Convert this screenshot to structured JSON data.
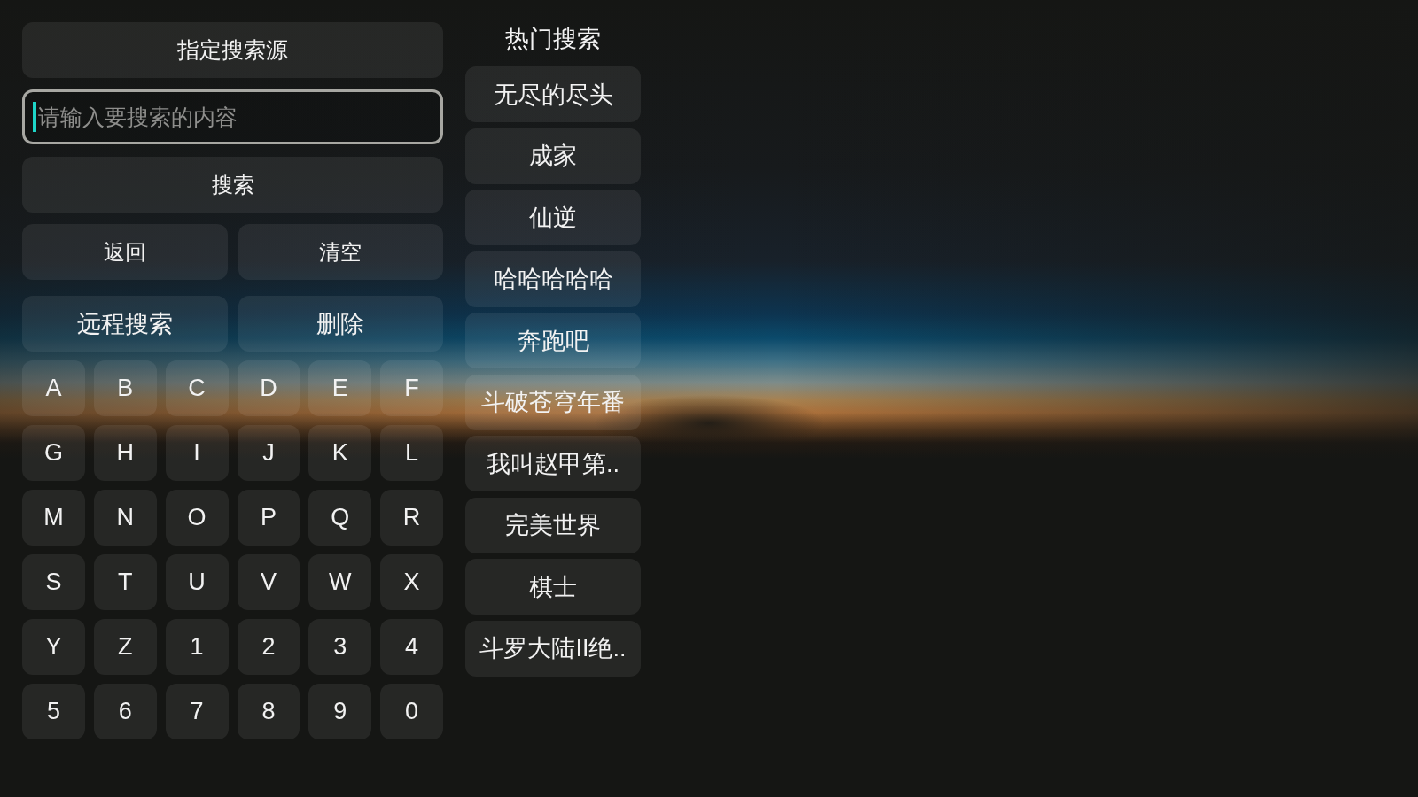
{
  "source_button": {
    "label": "指定搜索源"
  },
  "search_field": {
    "placeholder": "请输入要搜索的内容",
    "focused": true
  },
  "search_button": {
    "label": "搜索"
  },
  "action_rows": [
    {
      "buttons": [
        {
          "label": "返回"
        },
        {
          "label": "清空"
        }
      ]
    },
    {
      "buttons": [
        {
          "label": "远程搜索"
        },
        {
          "label": "删除"
        }
      ]
    }
  ],
  "keyboard": {
    "keys": [
      "A",
      "B",
      "C",
      "D",
      "E",
      "F",
      "G",
      "H",
      "I",
      "J",
      "K",
      "L",
      "M",
      "N",
      "O",
      "P",
      "Q",
      "R",
      "S",
      "T",
      "U",
      "V",
      "W",
      "X",
      "Y",
      "Z",
      "1",
      "2",
      "3",
      "4",
      "5",
      "6",
      "7",
      "8",
      "9",
      "0"
    ]
  },
  "hot_search": {
    "title": "热门搜索",
    "items": [
      "无尽的尽头",
      "成家",
      "仙逆",
      "哈哈哈哈哈",
      "奔跑吧",
      "斗破苍穹年番",
      "我叫赵甲第..",
      "完美世界",
      "棋士",
      "斗罗大陆II绝.."
    ]
  }
}
